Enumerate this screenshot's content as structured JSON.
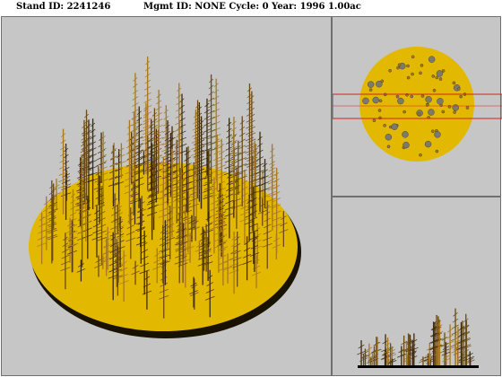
{
  "header": {
    "stand_label": "Stand ID:",
    "stand_id": "2241246",
    "mgmt_label": "Mgmt ID:",
    "mgmt_id": "NONE",
    "cycle_label": "Cycle:",
    "cycle": "0",
    "year_label": "Year:",
    "year": "1996",
    "area": "1.00ac"
  },
  "colors": {
    "background": "#c6c6c6",
    "ground": "#e3b800",
    "ground_edge": "#1a1200",
    "tree_trunk": "#6b4a14",
    "tree_dark": "#3d2a0a",
    "tree_light": "#a8781e",
    "crown_gray": "#7b7b6b",
    "selection_box": "#d62020"
  },
  "views": {
    "main": "perspective-view",
    "top": "plan-view",
    "side": "profile-view"
  }
}
